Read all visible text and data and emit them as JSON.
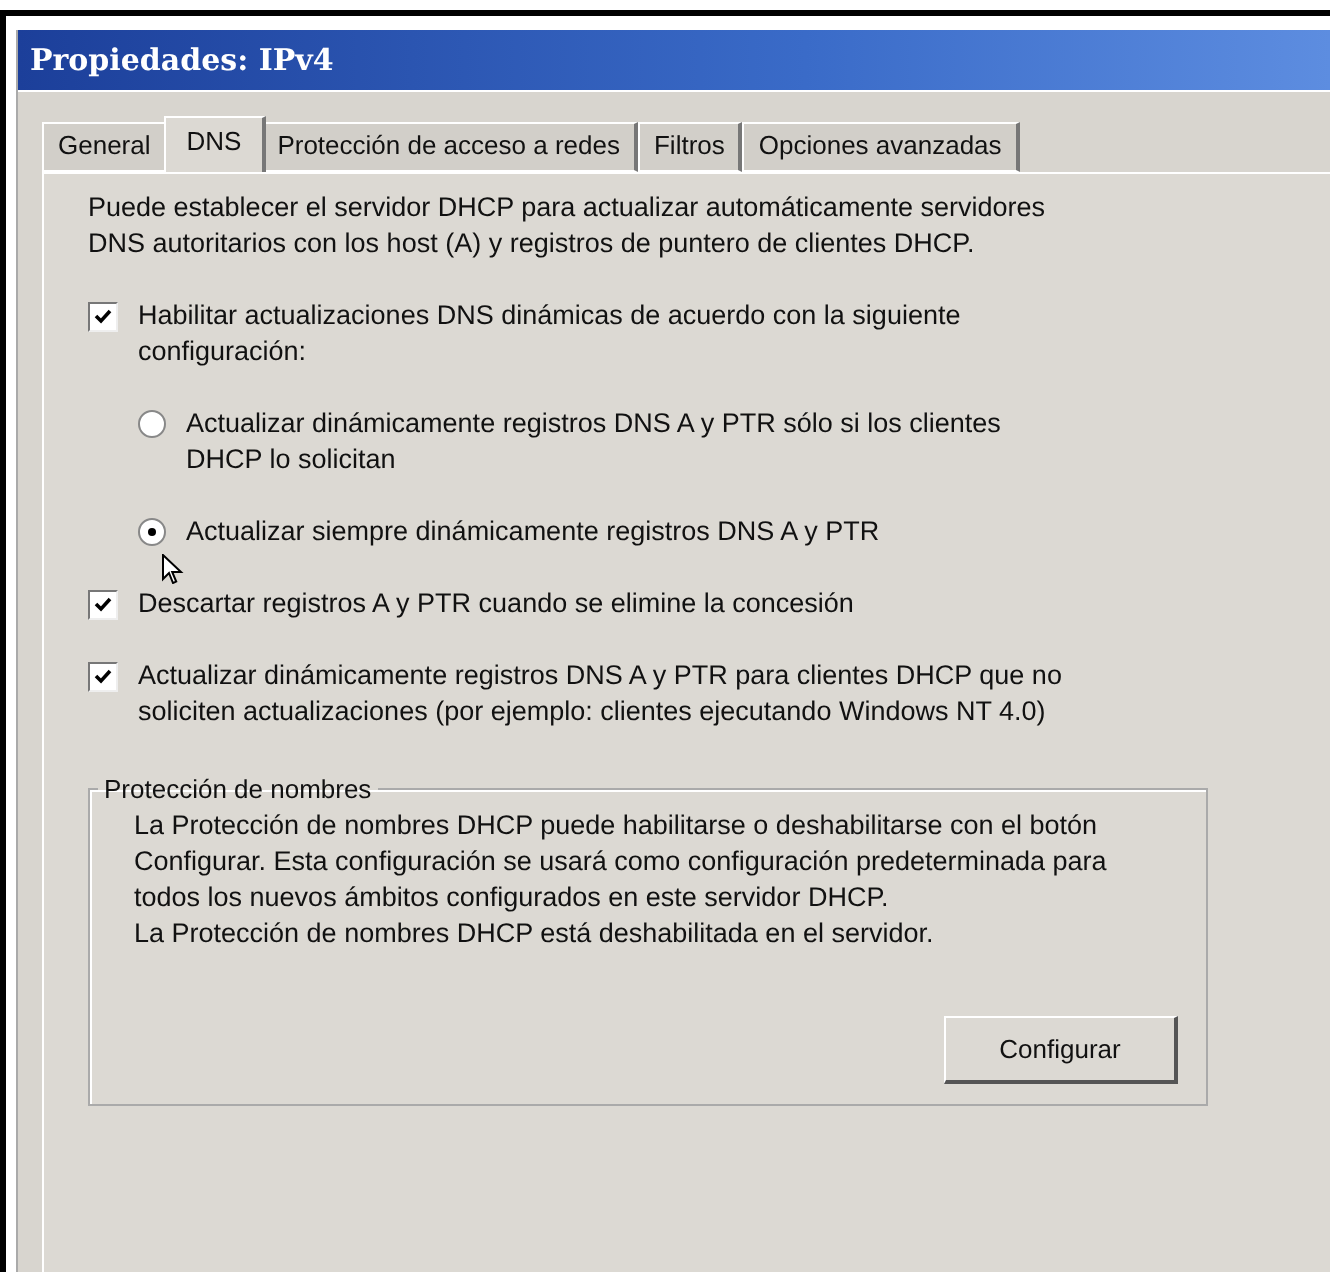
{
  "window": {
    "title": "Propiedades: IPv4"
  },
  "tabs": [
    {
      "label": "General",
      "selected": false
    },
    {
      "label": "DNS",
      "selected": true
    },
    {
      "label": "Protección de acceso a redes",
      "selected": false
    },
    {
      "label": "Filtros",
      "selected": false
    },
    {
      "label": "Opciones avanzadas",
      "selected": false
    }
  ],
  "intro": "Puede establecer el servidor DHCP para actualizar automáticamente servidores DNS autoritarios con los host (A) y registros de puntero de clientes DHCP.",
  "options": [
    {
      "kind": "checkbox",
      "label": "Habilitar actualizaciones DNS dinámicas de acuerdo con la  siguiente configuración:",
      "checked": true,
      "children": [
        {
          "kind": "radio",
          "label": "Actualizar dinámicamente registros DNS A y PTR sólo si los clientes DHCP lo solicitan",
          "selected": false
        },
        {
          "kind": "radio",
          "label": "Actualizar siempre dinámicamente registros DNS A y PTR",
          "selected": true
        }
      ]
    },
    {
      "kind": "checkbox",
      "label": "Descartar registros A y PTR cuando se elimine la concesión",
      "checked": true
    },
    {
      "kind": "checkbox",
      "label": "Actualizar dinámicamente registros DNS A y PTR para clientes DHCP que no soliciten actualizaciones (por ejemplo: clientes ejecutando Windows NT 4.0)",
      "checked": true
    }
  ],
  "name_protection": {
    "title": "Protección de nombres",
    "description": "La Protección de nombres DHCP puede habilitarse o deshabilitarse con el botón Configurar. Esta configuración se usará como configuración predeterminada para todos los nuevos ámbitos configurados en este servidor DHCP.",
    "status": "La Protección de nombres DHCP está deshabilitada en el servidor.",
    "button": "Configurar"
  }
}
